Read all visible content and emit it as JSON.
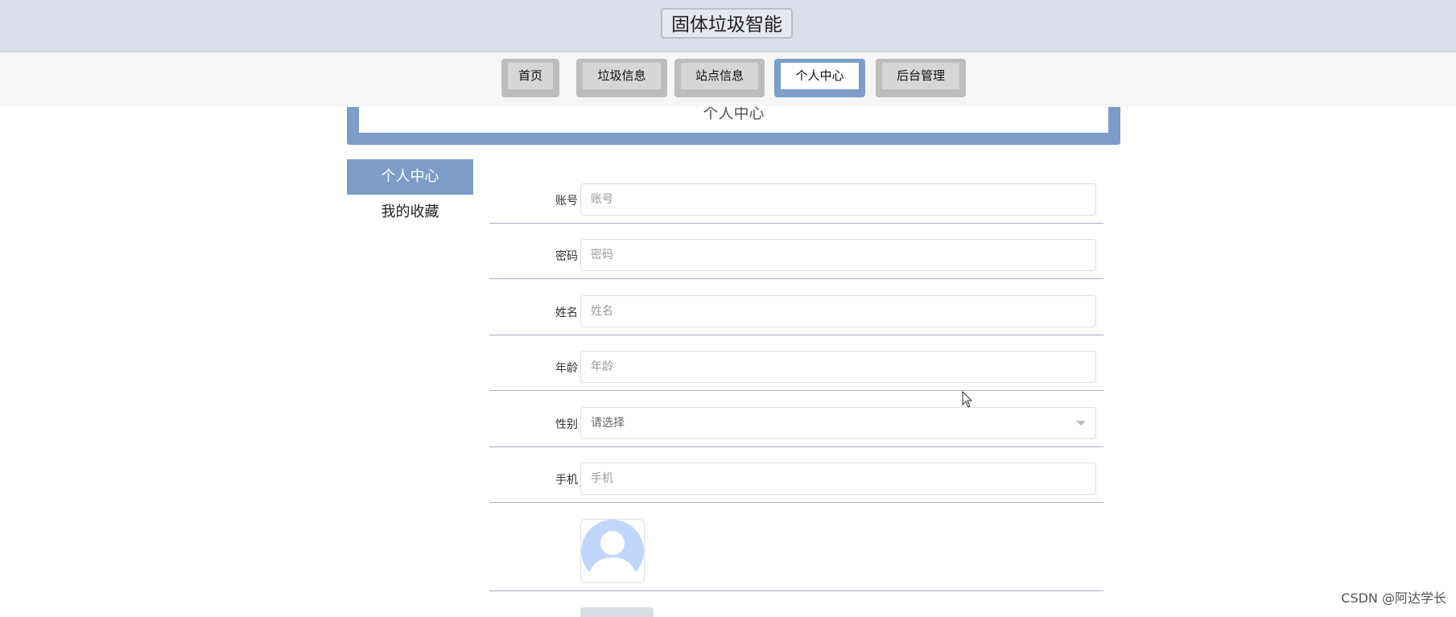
{
  "header": {
    "title": "固体垃圾智能"
  },
  "nav": {
    "items": [
      {
        "label": "首页"
      },
      {
        "label": "垃圾信息"
      },
      {
        "label": "站点信息"
      },
      {
        "label": "个人中心"
      },
      {
        "label": "后台管理"
      }
    ],
    "active": "个人中心"
  },
  "banner": {
    "title": "个人中心"
  },
  "side_menu": {
    "items": [
      {
        "label": "个人中心"
      },
      {
        "label": "我的收藏"
      }
    ],
    "active": "个人中心"
  },
  "form": {
    "account": {
      "label": "账号",
      "placeholder": "账号",
      "value": ""
    },
    "password": {
      "label": "密码",
      "placeholder": "密码",
      "value": ""
    },
    "name": {
      "label": "姓名",
      "placeholder": "姓名",
      "value": ""
    },
    "age": {
      "label": "年龄",
      "placeholder": "年龄",
      "value": ""
    },
    "gender": {
      "label": "性别",
      "placeholder": "请选择",
      "value": ""
    },
    "phone": {
      "label": "手机",
      "placeholder": "手机",
      "value": ""
    }
  },
  "watermark": "CSDN @阿达学长",
  "colors": {
    "accent": "#7b9dc7",
    "header_bg": "#d9dee8",
    "nav_button": "#bdbdbd",
    "avatar_tint": "#c0d6fa"
  }
}
